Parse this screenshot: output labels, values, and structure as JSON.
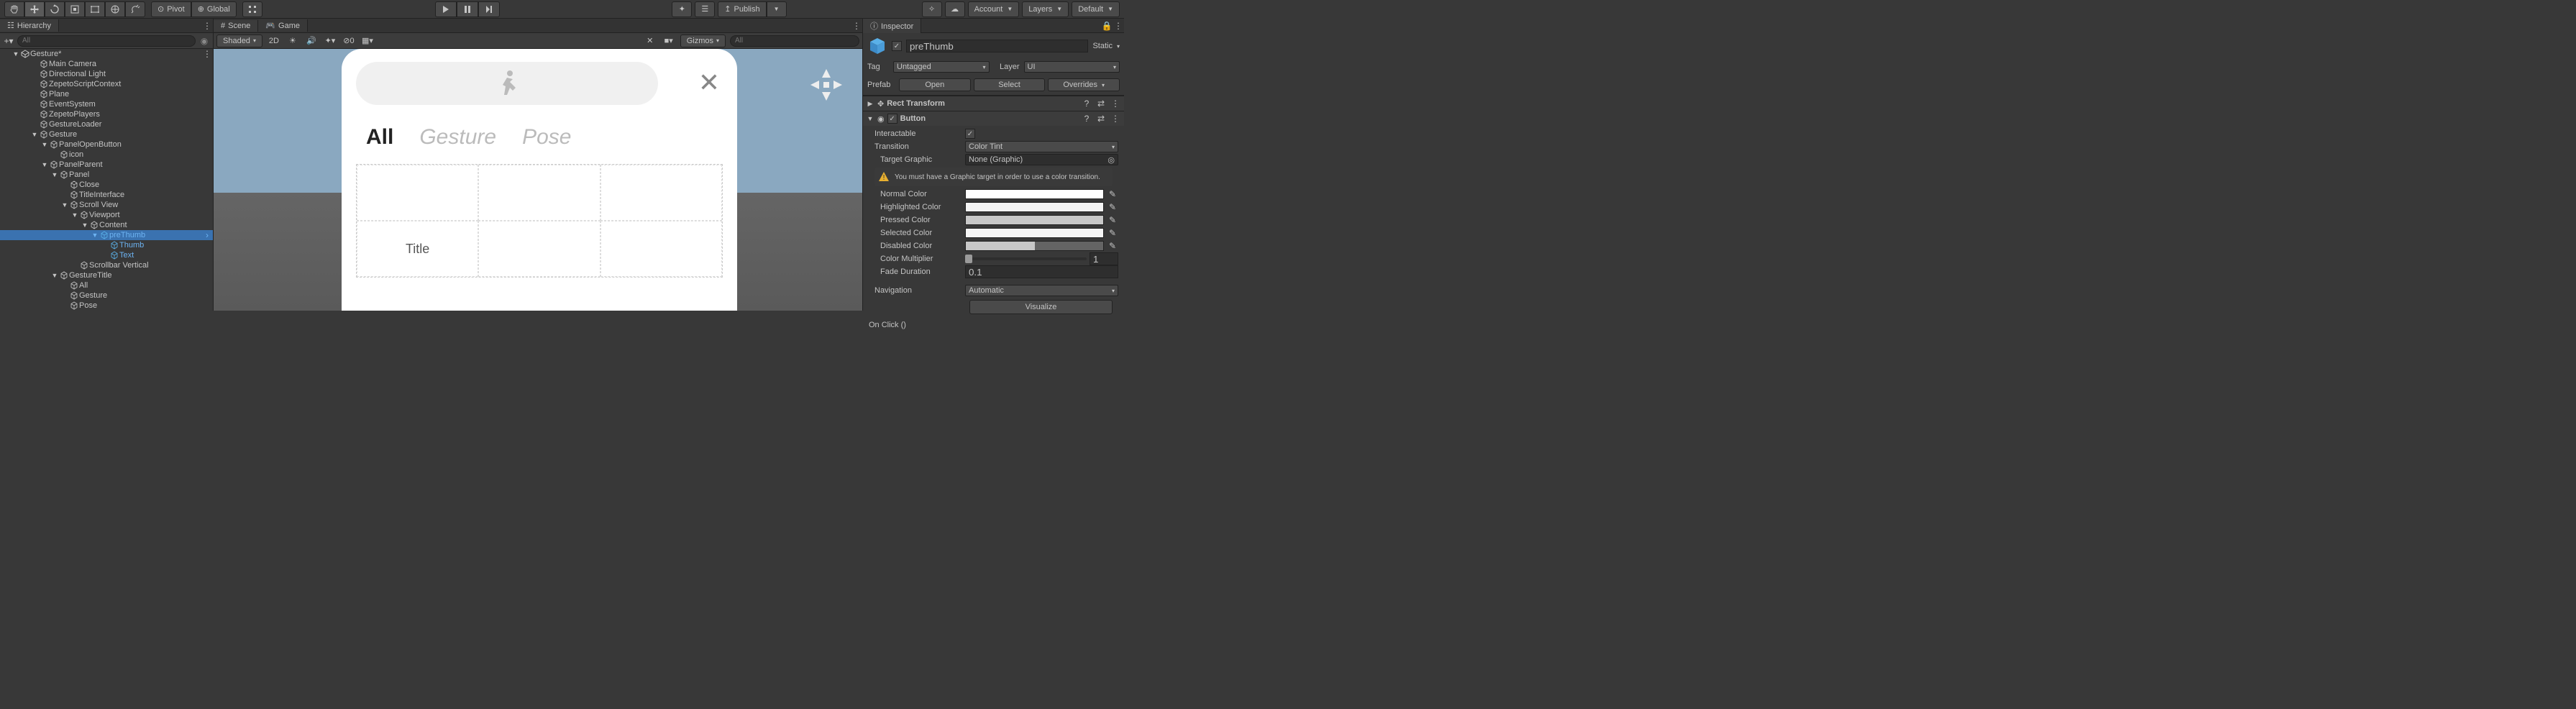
{
  "toolbar": {
    "pivot_label": "Pivot",
    "global_label": "Global",
    "publish_label": "Publish",
    "account_label": "Account",
    "layers_label": "Layers",
    "layout_label": "Default"
  },
  "hierarchy": {
    "tab": "Hierarchy",
    "search_placeholder": "All",
    "root": "Gesture*",
    "nodes": [
      {
        "label": "Main Camera",
        "indent": 1
      },
      {
        "label": "Directional Light",
        "indent": 1
      },
      {
        "label": "ZepetoScriptContext",
        "indent": 1
      },
      {
        "label": "Plane",
        "indent": 1
      },
      {
        "label": "EventSystem",
        "indent": 1
      },
      {
        "label": "ZepetoPlayers",
        "indent": 1
      },
      {
        "label": "GestureLoader",
        "indent": 1
      },
      {
        "label": "Gesture",
        "indent": 1,
        "expanded": true
      },
      {
        "label": "PanelOpenButton",
        "indent": 2,
        "expanded": true
      },
      {
        "label": "icon",
        "indent": 3
      },
      {
        "label": "PanelParent",
        "indent": 2,
        "expanded": true
      },
      {
        "label": "Panel",
        "indent": 3,
        "expanded": true
      },
      {
        "label": "Close",
        "indent": 4
      },
      {
        "label": "TitleInterface",
        "indent": 4
      },
      {
        "label": "Scroll View",
        "indent": 4,
        "expanded": true
      },
      {
        "label": "Viewport",
        "indent": 5,
        "expanded": true
      },
      {
        "label": "Content",
        "indent": 6,
        "expanded": true
      },
      {
        "label": "preThumb",
        "indent": 7,
        "expanded": true,
        "selected": true,
        "prefab": true
      },
      {
        "label": "Thumb",
        "indent": 8,
        "prefab": true
      },
      {
        "label": "Text",
        "indent": 8,
        "prefab": true
      },
      {
        "label": "Scrollbar Vertical",
        "indent": 5
      },
      {
        "label": "GestureTitle",
        "indent": 3,
        "expanded": true
      },
      {
        "label": "All",
        "indent": 4
      },
      {
        "label": "Gesture",
        "indent": 4
      },
      {
        "label": "Pose",
        "indent": 4
      }
    ]
  },
  "scene": {
    "tab_scene": "Scene",
    "tab_game": "Game",
    "shading": "Shaded",
    "mode_2d": "2D",
    "gizmos": "Gizmos",
    "search_placeholder": "All",
    "ui_tabs": {
      "all": "All",
      "gesture": "Gesture",
      "pose": "Pose"
    },
    "ui_title": "Title"
  },
  "inspector": {
    "tab": "Inspector",
    "name": "preThumb",
    "static_label": "Static",
    "tag_label": "Tag",
    "tag_value": "Untagged",
    "layer_label": "Layer",
    "layer_value": "UI",
    "prefab_label": "Prefab",
    "open": "Open",
    "select": "Select",
    "overrides": "Overrides",
    "rect_transform": "Rect Transform",
    "button": {
      "title": "Button",
      "interactable": "Interactable",
      "transition": "Transition",
      "transition_value": "Color Tint",
      "target_graphic": "Target Graphic",
      "target_value": "None (Graphic)",
      "warning": "You must have a Graphic target in order to use a color transition.",
      "normal_color": "Normal Color",
      "highlighted_color": "Highlighted Color",
      "pressed_color": "Pressed Color",
      "selected_color": "Selected Color",
      "disabled_color": "Disabled Color",
      "color_multiplier": "Color Multiplier",
      "color_mult_val": "1",
      "fade_duration": "Fade Duration",
      "fade_val": "0.1",
      "navigation": "Navigation",
      "nav_value": "Automatic",
      "visualize": "Visualize",
      "on_click": "On Click ()"
    }
  }
}
